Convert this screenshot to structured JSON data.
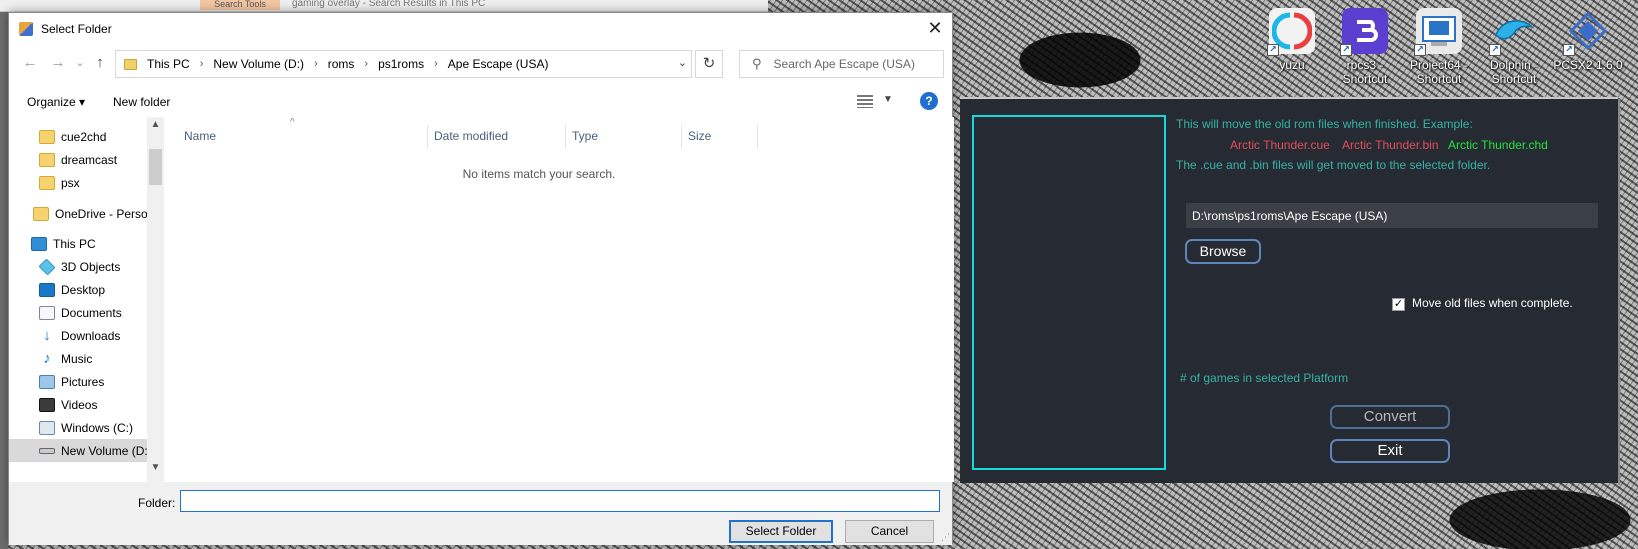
{
  "background_window": {
    "search_tools_label": "Search Tools",
    "title": "gaming overlay - Search Results in This PC"
  },
  "desktop_icons": [
    {
      "label": "yuzu",
      "icon": "yuzu-icon",
      "color": "#e8e8e8"
    },
    {
      "label": "rpcs3 - Shortcut",
      "icon": "rpcs3-icon",
      "color": "#5b3fd1"
    },
    {
      "label": "Project64 - Shortcut",
      "icon": "project64-icon",
      "color": "#e8e8e8"
    },
    {
      "label": "Dolphin - Shortcut",
      "icon": "dolphin-icon",
      "color": "#2bb0e8"
    },
    {
      "label": "PCSX2 1.6.0",
      "icon": "pcsx2-icon",
      "color": "#3a6cc8"
    }
  ],
  "dialog": {
    "title": "Select Folder",
    "close_glyph": "✕",
    "nav": {
      "back_glyph": "←",
      "forward_glyph": "→",
      "recent_glyph": "⌄",
      "up_glyph": "↑"
    },
    "breadcrumb": [
      "This PC",
      "New Volume (D:)",
      "roms",
      "ps1roms",
      "Ape Escape (USA)"
    ],
    "breadcrumb_sep": "›",
    "refresh_glyph": "↻",
    "search_placeholder": "Search Ape Escape (USA)",
    "toolbar": {
      "organize": "Organize ▾",
      "new_folder": "New folder",
      "help": "?"
    },
    "nav_pane": [
      {
        "label": "cue2chd",
        "icon": "folder-icon"
      },
      {
        "label": "dreamcast",
        "icon": "folder-icon"
      },
      {
        "label": "psx",
        "icon": "folder-icon"
      },
      {
        "label": "OneDrive - Personal",
        "icon": "onedrive-folder-icon"
      },
      {
        "label": "This PC",
        "icon": "this-pc-icon"
      },
      {
        "label": "3D Objects",
        "icon": "3d-objects-icon"
      },
      {
        "label": "Desktop",
        "icon": "desktop-icon"
      },
      {
        "label": "Documents",
        "icon": "documents-icon"
      },
      {
        "label": "Downloads",
        "icon": "downloads-icon"
      },
      {
        "label": "Music",
        "icon": "music-icon"
      },
      {
        "label": "Pictures",
        "icon": "pictures-icon"
      },
      {
        "label": "Videos",
        "icon": "videos-icon"
      },
      {
        "label": "Windows (C:)",
        "icon": "drive-c-icon"
      },
      {
        "label": "New Volume (D:)",
        "icon": "drive-d-icon"
      }
    ],
    "columns": [
      "Name",
      "Date modified",
      "Type",
      "Size"
    ],
    "empty_message": "No items match your search.",
    "folder_label": "Folder:",
    "folder_value": "",
    "select_button": "Select Folder",
    "cancel_button": "Cancel"
  },
  "converter": {
    "info_line": "This will move the old rom files when finished.   Example:",
    "example_cue": "Arctic Thunder.cue",
    "example_bin": "Arctic Thunder.bin",
    "example_chd": "Arctic Thunder.chd",
    "move_note": "The .cue and .bin files will get moved to the selected folder.",
    "path_value": "D:\\roms\\ps1roms\\Ape Escape (USA)",
    "browse_button": "Browse",
    "move_checkbox_label": "Move old files when complete.",
    "move_checked": true,
    "games_count_label": "# of games in selected Platform",
    "convert_button": "Convert",
    "exit_button": "Exit",
    "colors": {
      "accent_border": "#16d9dc",
      "teal_text": "#36b2a4",
      "red_text": "#e0505a",
      "green_text": "#28e03c",
      "background": "#262a33"
    }
  }
}
